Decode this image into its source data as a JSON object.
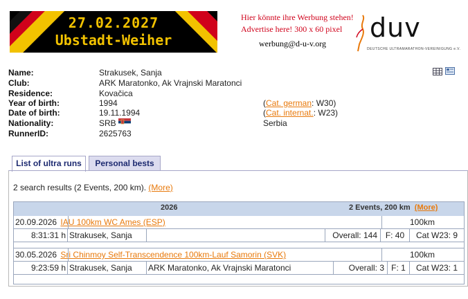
{
  "banner": {
    "date": "27.02.2027",
    "place": "Ubstadt-Weiher"
  },
  "ad": {
    "line1": "Hier könnte ihre Werbung stehen!",
    "line2": "Advertise here!   300 x 60 pixel",
    "email": "werbung@d-u-v.org"
  },
  "duv_logo": {
    "wordmark": "duv",
    "subtitle": "DEUTSCHE ULTRAMARATHON-VEREINIGUNG e.V."
  },
  "profile": {
    "labels": {
      "name": "Name:",
      "club": "Club:",
      "residence": "Residence:",
      "year_of_birth": "Year of birth:",
      "date_of_birth": "Date of birth:",
      "nationality": "Nationality:",
      "runner_id": "RunnerID:"
    },
    "name": "Strakusek, Sanja",
    "club": "ARK Maratonko, Ak Vrajnski Maratonci",
    "residence": "Kovačica",
    "year_of_birth": "1994",
    "date_of_birth": "19.11.1994",
    "nationality": "SRB",
    "runner_id": "2625763",
    "cat_german_open": "(",
    "cat_german_link": "Cat. german",
    "cat_german_value": ": W30)",
    "cat_internat_open": "(",
    "cat_internat_link": "Cat. internat.",
    "cat_internat_value": ": W23)",
    "country": "Serbia"
  },
  "tabs": [
    {
      "label": "List of ultra runs",
      "active": true
    },
    {
      "label": "Personal bests",
      "active": false
    }
  ],
  "results": {
    "summary": "2 search results (2 Events, 200 km).",
    "more": "(More)"
  },
  "table": {
    "year": "2026",
    "summary": "2 Events, 200 km",
    "more": "(More)",
    "events": [
      {
        "date": "20.09.2026",
        "name": "IAU 100km WC Ames (ESP)",
        "distance": "100km",
        "time": "8:31:31 h",
        "runner": "Strakusek, Sanja",
        "club": "",
        "overall": "Overall: 144",
        "gender_rank": "F: 40",
        "cat_rank": "Cat W23: 9"
      },
      {
        "date": "30.05.2026",
        "name": "Sri Chinmoy Self-Transcendence 100km-Lauf Samorin (SVK)",
        "distance": "100km",
        "time": "9:23:59 h",
        "runner": "Strakusek, Sanja",
        "club": "ARK Maratonko, Ak Vrajnski Maratonci",
        "overall": "Overall: 3",
        "gender_rank": "F: 1",
        "cat_rank": "Cat W23: 1"
      }
    ]
  },
  "colors": {
    "link": "#e8790b",
    "table_header": "#c8d6ea",
    "banner_text": "#f2c200",
    "ad_text": "#d0021b"
  }
}
